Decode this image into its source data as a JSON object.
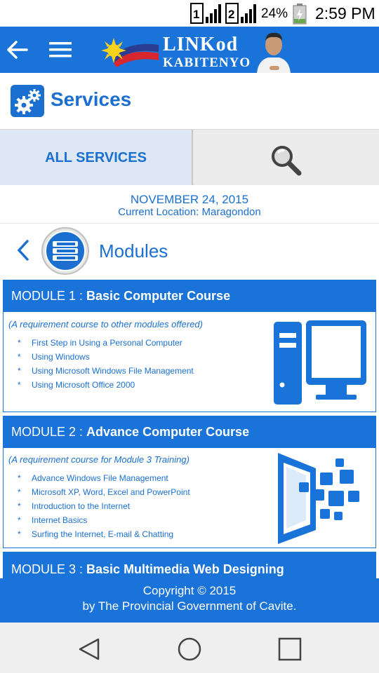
{
  "status_bar": {
    "sim1": "1",
    "sim2": "2",
    "battery_percent": "24%",
    "time": "2:59 PM"
  },
  "app_bar": {
    "logo_line1": "LINKod",
    "logo_line2": "KABITENYO",
    "icons": [
      "back-arrow-icon",
      "menu-icon"
    ]
  },
  "services": {
    "title": "Services",
    "icon": "gears-icon"
  },
  "tabs": {
    "all_services_label": "ALL SERVICES",
    "search_icon": "search-icon"
  },
  "info": {
    "date": "NOVEMBER 24, 2015",
    "location": "Current Location: Maragondon"
  },
  "modules_header": {
    "title": "Modules",
    "icon": "stack-icon"
  },
  "modules": [
    {
      "prefix": "MODULE 1 : ",
      "name": "Basic Computer Course",
      "note": "(A requirement course to other modules offered)",
      "items": [
        "First  Step in Using  a  Personal Computer",
        "Using Windows",
        "Using   Microsoft   Windows  File  Management",
        "Using  Microsoft  Office  2000"
      ],
      "art": "computer-icon"
    },
    {
      "prefix": "MODULE 2 : ",
      "name": "Advance Computer Course",
      "note": "(A requirement course for Module 3 Training)",
      "items": [
        "Advance Windows File Management",
        "Microsoft XP, Word, Excel and PowerPoint",
        "Introduction to the Internet",
        "Internet Basics",
        "Surfing the Internet, E-mail & Chatting"
      ],
      "art": "portal-icon"
    },
    {
      "prefix": "MODULE 3 : ",
      "name": "Basic Multimedia Web Designing"
    }
  ],
  "bullet": "*",
  "footer": {
    "line1": "Copyright © 2015",
    "line2": "by The Provincial Government of Cavite."
  },
  "nav": [
    "back-triangle-icon",
    "home-circle-icon",
    "recents-square-icon"
  ],
  "colors": {
    "primary": "#1a73d9",
    "text_blue": "#1a6fd0",
    "tab_active_bg": "#dde8f4",
    "nav_bg": "#efefef"
  }
}
